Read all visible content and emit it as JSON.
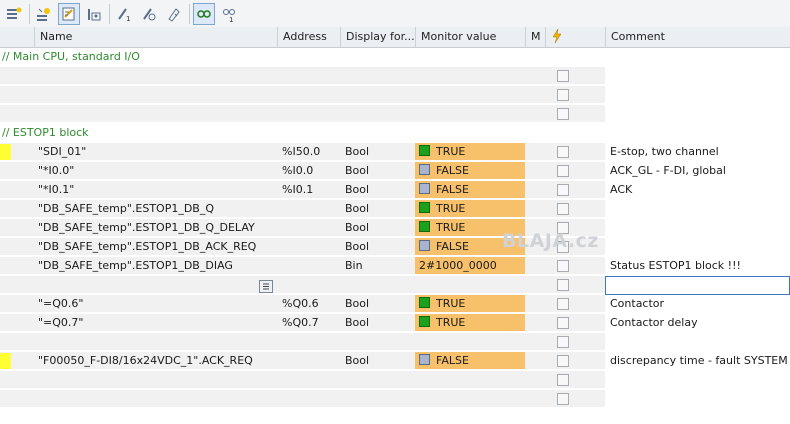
{
  "colors": {
    "accent_comment": "#2e8b2e",
    "monitor_bg": "#f7c16b",
    "true_indicator": "#1da11d",
    "false_indicator": "#a9b5cf",
    "marker": "#ffff33"
  },
  "toolbar": {
    "icons": [
      "insert-row-icon",
      "insert-row-below-icon",
      "modify-values-icon",
      "monitor-all-icon",
      "modify-now-icon",
      "modify-on-trigger-icon",
      "force-icon",
      "glasses-monitor-icon",
      "glasses-once-icon"
    ]
  },
  "columns": {
    "name": "Name",
    "address": "Address",
    "display_format": "Display for...",
    "monitor_value": "Monitor value",
    "modify_short": "M",
    "force_icon": "lightning-icon",
    "comment": "Comment"
  },
  "rows": [
    {
      "kind": "comment",
      "text": "// Main CPU, standard I/O"
    },
    {
      "kind": "empty"
    },
    {
      "kind": "empty"
    },
    {
      "kind": "empty"
    },
    {
      "kind": "comment",
      "text": "// ESTOP1 block"
    },
    {
      "kind": "data",
      "marker": true,
      "name": "\"SDI_01\"",
      "address": "%I50.0",
      "format": "Bool",
      "value": "TRUE",
      "state": "true",
      "comment": "E-stop, two channel"
    },
    {
      "kind": "data",
      "name": "\"*I0.0\"",
      "address": "%I0.0",
      "format": "Bool",
      "value": "FALSE",
      "state": "false",
      "comment": "ACK_GL - F-DI, global"
    },
    {
      "kind": "data",
      "name": "\"*I0.1\"",
      "address": "%I0.1",
      "format": "Bool",
      "value": "FALSE",
      "state": "false",
      "comment": "ACK"
    },
    {
      "kind": "data",
      "name": "\"DB_SAFE_temp\".ESTOP1_DB_Q",
      "address": "",
      "format": "Bool",
      "value": "TRUE",
      "state": "true",
      "comment": ""
    },
    {
      "kind": "data",
      "name": "\"DB_SAFE_temp\".ESTOP1_DB_Q_DELAY",
      "address": "",
      "format": "Bool",
      "value": "TRUE",
      "state": "true",
      "comment": ""
    },
    {
      "kind": "data",
      "name": "\"DB_SAFE_temp\".ESTOP1_DB_ACK_REQ",
      "address": "",
      "format": "Bool",
      "value": "FALSE",
      "state": "false",
      "comment": ""
    },
    {
      "kind": "data",
      "name": "\"DB_SAFE_temp\".ESTOP1_DB_DIAG",
      "address": "",
      "format": "Bin",
      "value": "2#1000_0000",
      "state": "none",
      "comment": "Status ESTOP1 block !!!"
    },
    {
      "kind": "editing"
    },
    {
      "kind": "data",
      "name": "\"=Q0.6\"",
      "address": "%Q0.6",
      "format": "Bool",
      "value": "TRUE",
      "state": "true",
      "comment": "Contactor"
    },
    {
      "kind": "data",
      "name": "\"=Q0.7\"",
      "address": "%Q0.7",
      "format": "Bool",
      "value": "TRUE",
      "state": "true",
      "comment": "Contactor delay"
    },
    {
      "kind": "empty"
    },
    {
      "kind": "data",
      "marker": true,
      "name": "\"F00050_F-DI8/16x24VDC_1\".ACK_REQ",
      "address": "",
      "format": "Bool",
      "value": "FALSE",
      "state": "false",
      "comment": "discrepancy time - fault SYSTEM"
    },
    {
      "kind": "empty"
    },
    {
      "kind": "empty"
    }
  ],
  "watermark": "BLAJA.cz"
}
